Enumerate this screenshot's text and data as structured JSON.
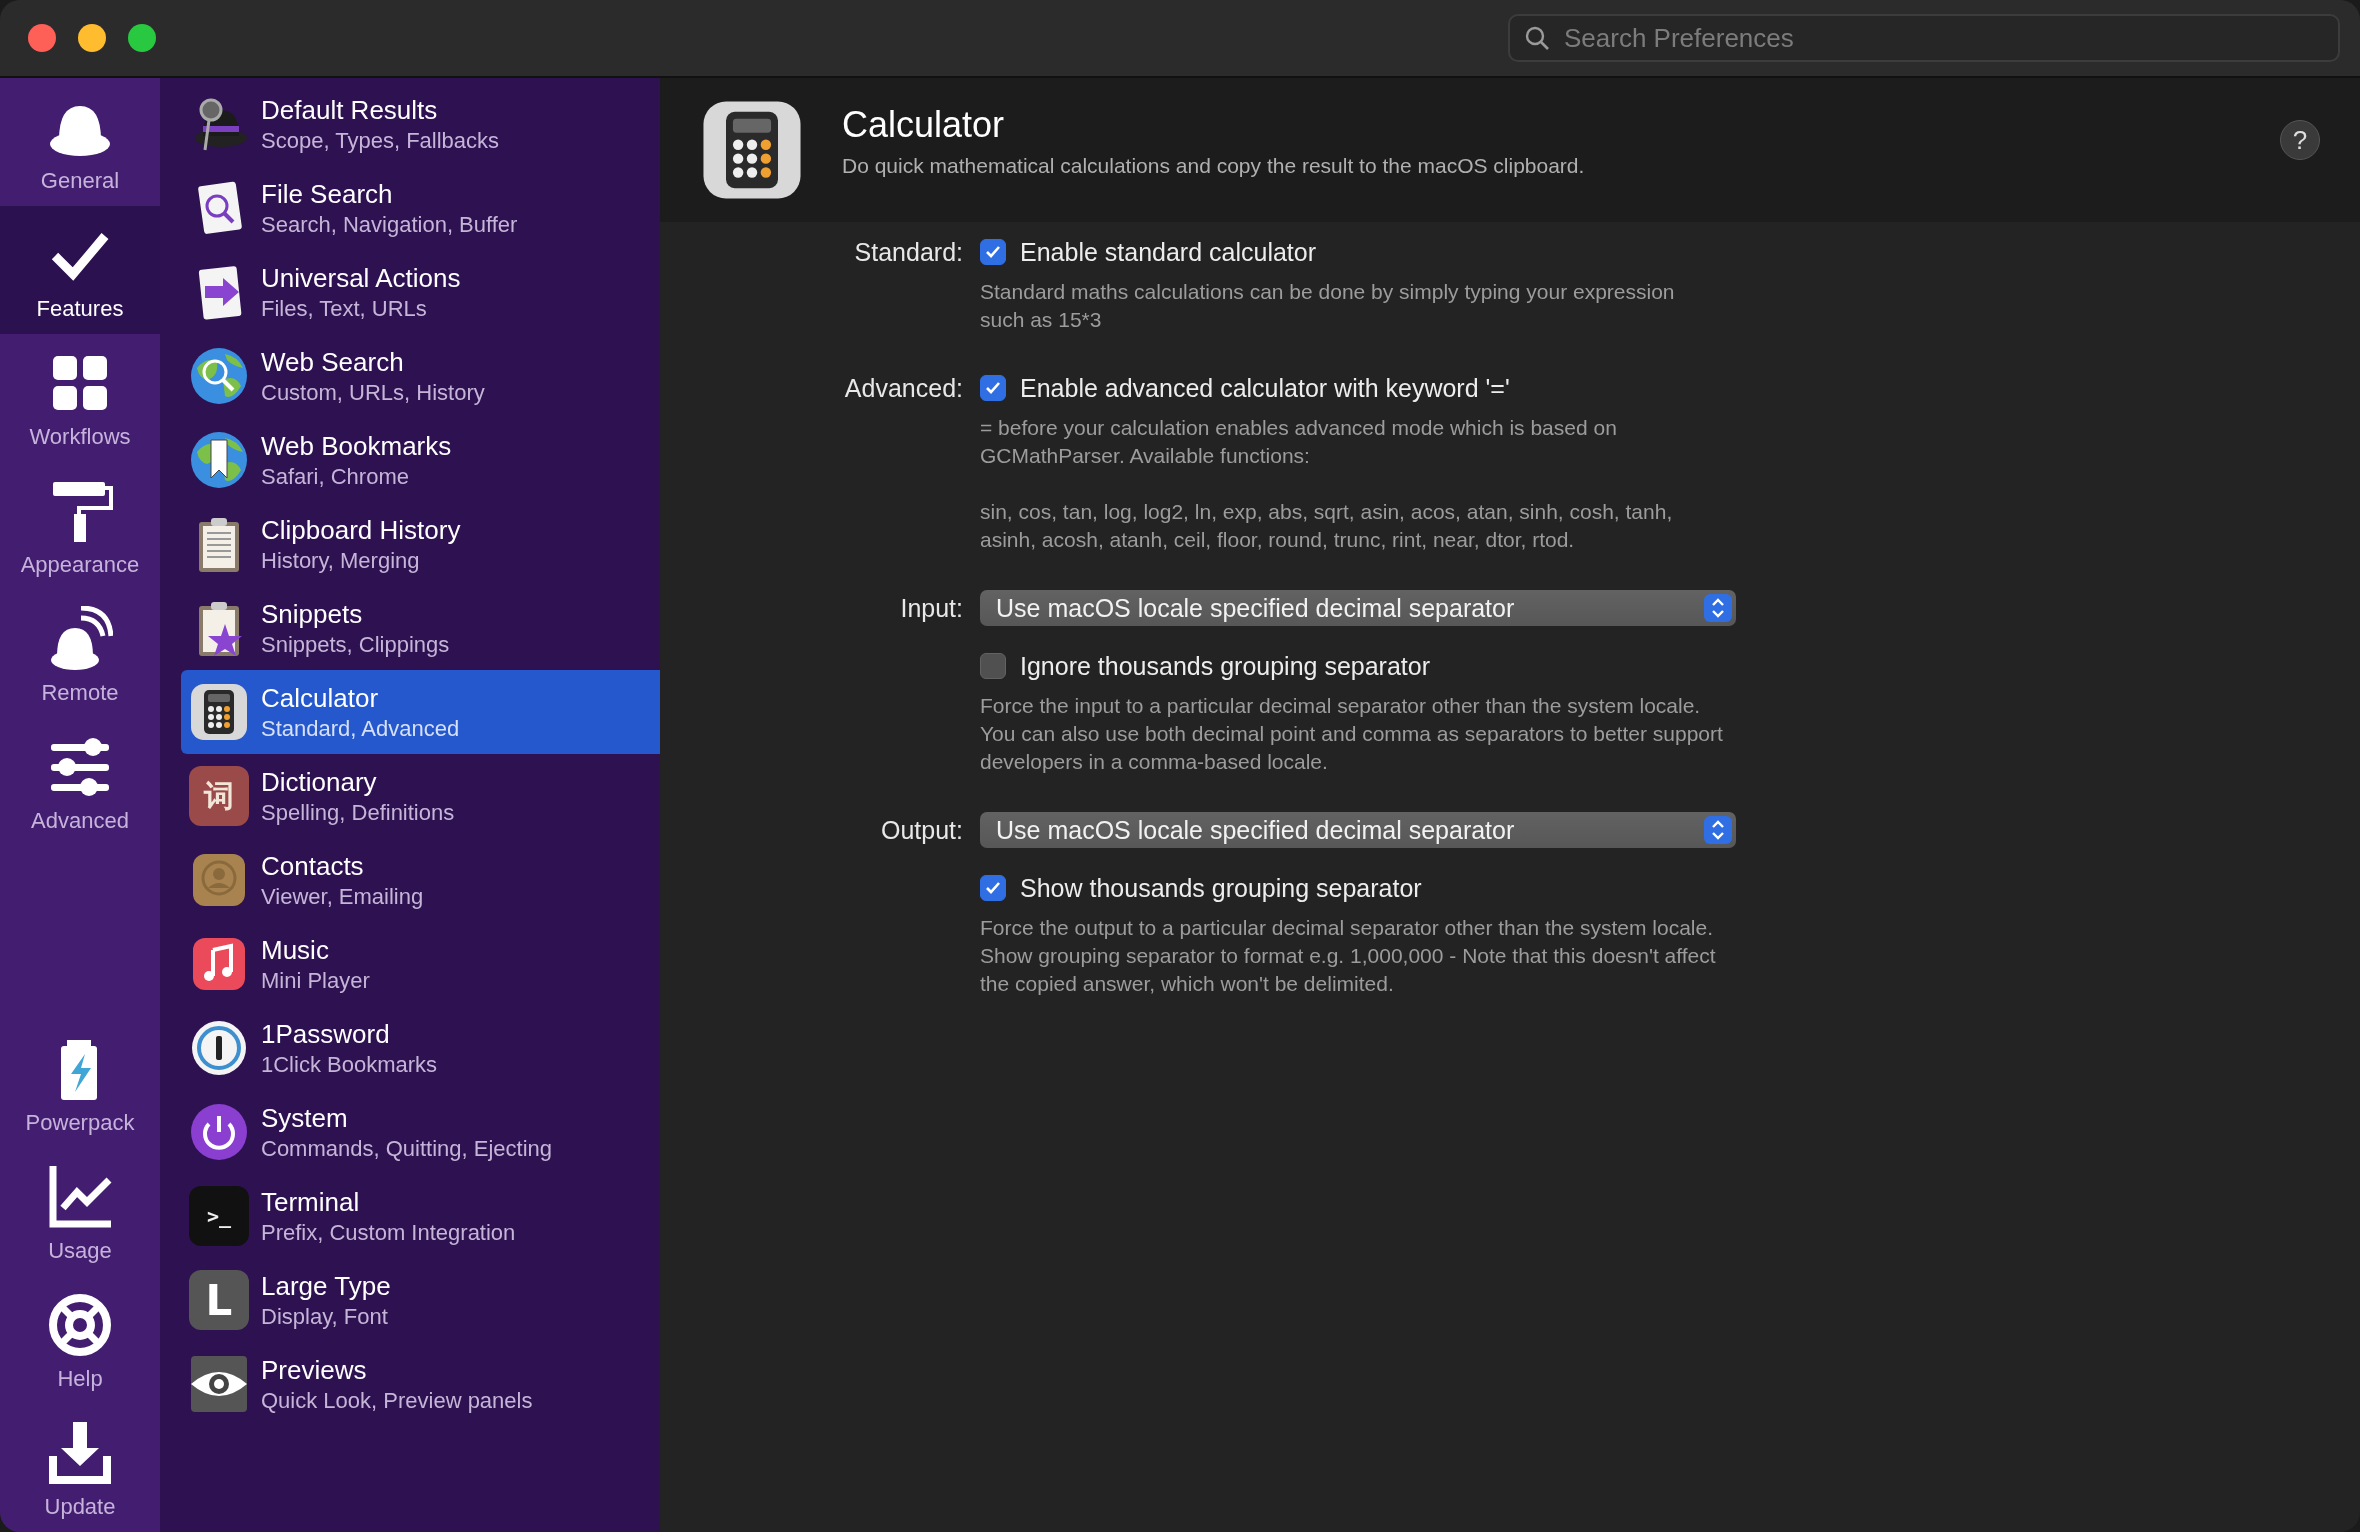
{
  "window": {
    "search": {
      "placeholder": "Search Preferences"
    }
  },
  "nav": {
    "top": [
      {
        "label": "General",
        "selected": false
      },
      {
        "label": "Features",
        "selected": true
      },
      {
        "label": "Workflows",
        "selected": false
      },
      {
        "label": "Appearance",
        "selected": false
      },
      {
        "label": "Remote",
        "selected": false
      },
      {
        "label": "Advanced",
        "selected": false
      }
    ],
    "bottom": [
      {
        "label": "Powerpack",
        "selected": false
      },
      {
        "label": "Usage",
        "selected": false
      },
      {
        "label": "Help",
        "selected": false
      },
      {
        "label": "Update",
        "selected": false
      }
    ]
  },
  "features": [
    {
      "title": "Default Results",
      "subtitle": "Scope, Types, Fallbacks",
      "selected": false
    },
    {
      "title": "File Search",
      "subtitle": "Search, Navigation, Buffer",
      "selected": false
    },
    {
      "title": "Universal Actions",
      "subtitle": "Files, Text, URLs",
      "selected": false
    },
    {
      "title": "Web Search",
      "subtitle": "Custom, URLs, History",
      "selected": false
    },
    {
      "title": "Web Bookmarks",
      "subtitle": "Safari, Chrome",
      "selected": false
    },
    {
      "title": "Clipboard History",
      "subtitle": "History, Merging",
      "selected": false
    },
    {
      "title": "Snippets",
      "subtitle": "Snippets, Clippings",
      "selected": false
    },
    {
      "title": "Calculator",
      "subtitle": "Standard, Advanced",
      "selected": true
    },
    {
      "title": "Dictionary",
      "subtitle": "Spelling, Definitions",
      "selected": false,
      "icon_text": "词"
    },
    {
      "title": "Contacts",
      "subtitle": "Viewer, Emailing",
      "selected": false
    },
    {
      "title": "Music",
      "subtitle": "Mini Player",
      "selected": false
    },
    {
      "title": "1Password",
      "subtitle": "1Click Bookmarks",
      "selected": false
    },
    {
      "title": "System",
      "subtitle": "Commands, Quitting, Ejecting",
      "selected": false
    },
    {
      "title": "Terminal",
      "subtitle": "Prefix, Custom Integration",
      "selected": false,
      "icon_text": ">_"
    },
    {
      "title": "Large Type",
      "subtitle": "Display, Font",
      "selected": false,
      "icon_text": "L"
    },
    {
      "title": "Previews",
      "subtitle": "Quick Look, Preview panels",
      "selected": false
    }
  ],
  "panel": {
    "title": "Calculator",
    "description": "Do quick mathematical calculations and copy the result to the macOS clipboard.",
    "help_button": "?",
    "settings": [
      {
        "kind": "checkbox",
        "label": "Standard:",
        "text": "Enable standard calculator",
        "checked": true,
        "description": [
          [
            "Standard maths calculations can be done by simply typing your expression",
            "such as 15*3"
          ]
        ]
      },
      {
        "kind": "checkbox",
        "label": "Advanced:",
        "text": "Enable advanced calculator with keyword '='",
        "checked": true,
        "description": [
          [
            "= before your calculation enables advanced mode which is based on",
            "GCMathParser. Available functions:"
          ],
          [
            "sin, cos, tan, log, log2, ln, exp, abs, sqrt, asin, acos, atan, sinh, cosh, tanh,",
            "asinh, acosh, atanh, ceil, floor, round, trunc, rint, near, dtor, rtod."
          ]
        ]
      },
      {
        "kind": "select",
        "label": "Input:",
        "value": "Use macOS locale specified decimal separator"
      },
      {
        "kind": "checkbox",
        "text": "Ignore thousands grouping separator",
        "checked": false,
        "description": [
          [
            "Force the input to a particular decimal separator other than the system locale.",
            "You can also use both decimal point and comma as separators to better support",
            "developers in a comma-based locale."
          ]
        ]
      },
      {
        "kind": "select",
        "label": "Output:",
        "value": "Use macOS locale specified decimal separator"
      },
      {
        "kind": "checkbox",
        "text": "Show thousands grouping separator",
        "checked": true,
        "description": [
          [
            "Force the output to a particular decimal separator other than the system locale.",
            "Show grouping separator to format e.g. 1,000,000 - Note that this doesn't affect",
            "the copied answer, which won't be delimited."
          ]
        ]
      }
    ]
  }
}
